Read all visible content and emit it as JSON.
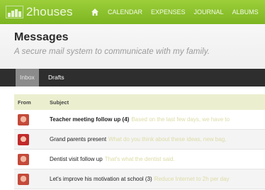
{
  "app": {
    "logo_text": "2houses"
  },
  "nav": {
    "items": [
      "CALENDAR",
      "EXPENSES",
      "JOURNAL",
      "ALBUMS"
    ]
  },
  "header": {
    "title": "Messages",
    "subtitle": "A secure mail system to communicate with my family."
  },
  "tabs": {
    "inbox": "Inbox",
    "drafts": "Drafts"
  },
  "table": {
    "columns": {
      "from": "From",
      "subject": "Subject"
    },
    "rows": [
      {
        "subject": "Teacher meeting follow up (4)",
        "bold": true,
        "preview": "Based on the last few days, we have to"
      },
      {
        "subject": "Grand parents present",
        "bold": false,
        "preview": "What do you think about these ideas, new bag,"
      },
      {
        "subject": "Dentist visit follow up",
        "bold": false,
        "preview": "That's what the dentist said."
      },
      {
        "subject": "Let's improve his motivation at school (3)",
        "bold": false,
        "preview": "Reduce Internet to 2h per day"
      }
    ]
  },
  "colors": {
    "topbar": "#8cc62f",
    "tabbar": "#2e2e2e",
    "table_header": "#ecefcf"
  }
}
